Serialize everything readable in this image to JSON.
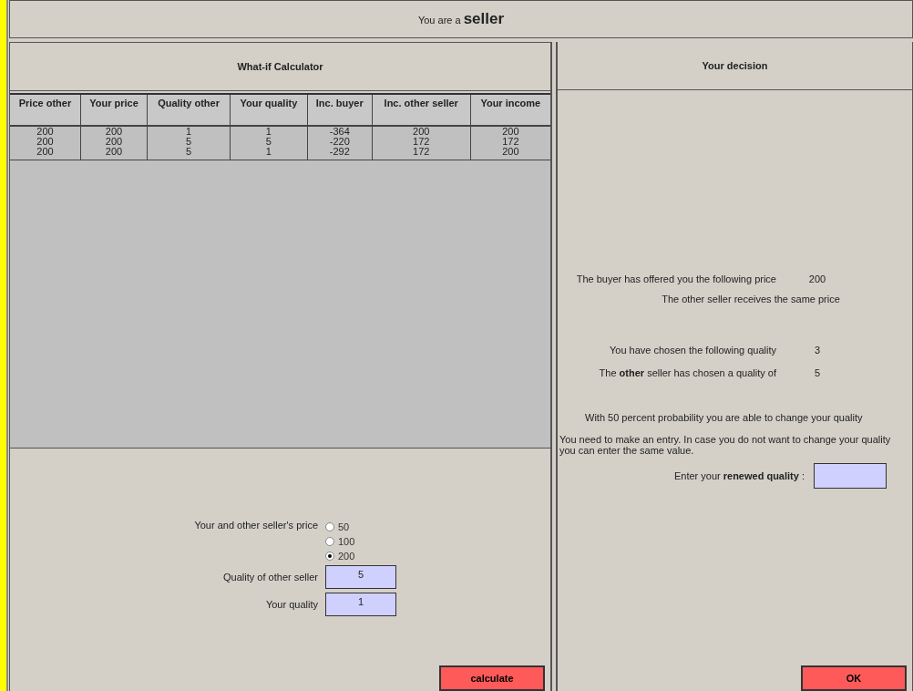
{
  "header": {
    "text": "You are a **seller**"
  },
  "calculator": {
    "title": "What-if Calculator",
    "columns": [
      "Price other",
      "Your price",
      "Quality other",
      "Your quality",
      "Inc. buyer",
      "Inc. other seller",
      "Your income"
    ],
    "rows": [
      [
        "200",
        "200",
        "1",
        "1",
        "-364",
        "200",
        "200"
      ],
      [
        "200",
        "200",
        "5",
        "5",
        "-220",
        "172",
        "172"
      ],
      [
        "200",
        "200",
        "5",
        "1",
        "-292",
        "172",
        "200"
      ]
    ],
    "price_label": "Your and other seller's price",
    "price_options": [
      {
        "label": "50",
        "selected": false
      },
      {
        "label": "100",
        "selected": false
      },
      {
        "label": "200",
        "selected": true
      }
    ],
    "other_quality": {
      "label": "Quality of other seller",
      "value": "5"
    },
    "your_quality": {
      "label": "Your quality",
      "value": "1"
    },
    "button": "calculate"
  },
  "decision": {
    "title": "Your decision",
    "offer": {
      "label": "The buyer has offered you the following price",
      "value": "200"
    },
    "same_price": "The other seller receives the same price",
    "chosen": {
      "label": "You have chosen the following quality",
      "value": "3"
    },
    "other_chosen": {
      "label": "The **other** seller has chosen a quality of",
      "value": "5"
    },
    "probability": "With 50 percent probability you are able to change your quality",
    "instruction": "You need to make an entry. In case you do not want to change your quality you can enter the same value.",
    "renewed_label": "Enter your **renewed quality** :",
    "button": "OK"
  }
}
